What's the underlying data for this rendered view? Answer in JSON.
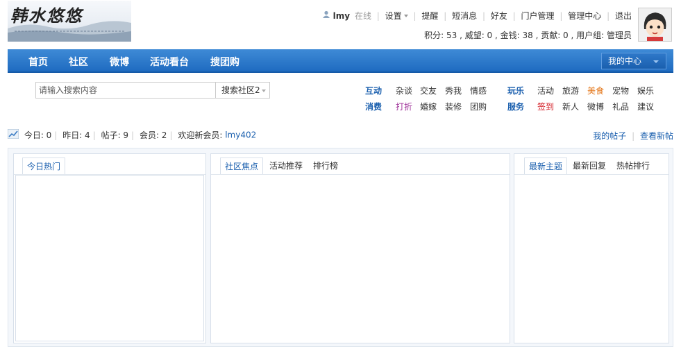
{
  "header": {
    "logo_text": "韩水悠悠",
    "user": {
      "name": "lmy",
      "status": "在线",
      "settings": "设置",
      "links": [
        "提醒",
        "短消息",
        "好友",
        "门户管理",
        "管理中心",
        "退出"
      ]
    },
    "stats_text": "积分: 53 , 威望: 0 , 金钱: 38 , 贡献: 0 , 用户组: 管理员"
  },
  "nav": {
    "items": [
      "首页",
      "社区",
      "微博",
      "活动看台",
      "搜团购"
    ],
    "center_label": "我的中心"
  },
  "search": {
    "placeholder": "请输入搜索内容",
    "scope": "搜索社区2"
  },
  "quicklinks": {
    "interact": {
      "label": "互动",
      "items": [
        "杂谈",
        "交友",
        "秀我",
        "情感"
      ]
    },
    "consume": {
      "label": "消费",
      "items": [
        "打折",
        "婚嫁",
        "装修",
        "团购"
      ]
    },
    "play": {
      "label": "玩乐",
      "items": [
        "活动",
        "旅游",
        "美食",
        "宠物",
        "娱乐"
      ]
    },
    "service": {
      "label": "服务",
      "items": [
        "签到",
        "新人",
        "微博",
        "礼品",
        "建议"
      ]
    }
  },
  "site_stats": {
    "today": "今日: 0",
    "yesterday": "昨日: 4",
    "posts": "帖子: 9",
    "members": "会员: 2",
    "welcome": "欢迎新会员:",
    "new_member": "lmy402",
    "my_posts": "我的帖子",
    "view_new": "查看新帖"
  },
  "panels": {
    "left": {
      "tab": "今日热门"
    },
    "middle": {
      "tabs": [
        "社区焦点",
        "活动推荐",
        "排行榜"
      ]
    },
    "right": {
      "tabs": [
        "最新主题",
        "最新回复",
        "热帖排行"
      ]
    }
  },
  "colors": {
    "nav_blue": "#1f6bc0",
    "link_blue": "#1a5fae",
    "highlight_orange": "#e3700f",
    "highlight_red": "#d2141d",
    "highlight_purple": "#a0339a"
  }
}
